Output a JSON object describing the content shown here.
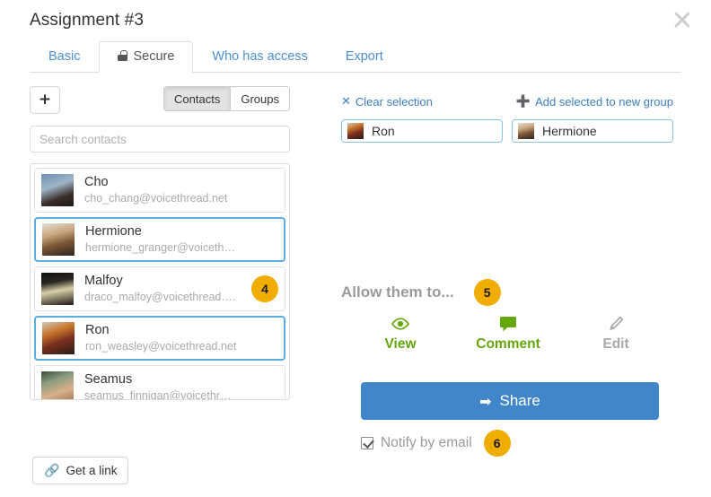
{
  "header": {
    "title": "Assignment #3",
    "close_icon": "close-icon"
  },
  "tabs": [
    {
      "label": "Basic",
      "active": false,
      "icon": null
    },
    {
      "label": "Secure",
      "active": true,
      "icon": "lock-icon"
    },
    {
      "label": "Who has access",
      "active": false,
      "icon": null
    },
    {
      "label": "Export",
      "active": false,
      "icon": null
    }
  ],
  "left_panel": {
    "add_button_label": "+",
    "segmented": {
      "contacts_label": "Contacts",
      "groups_label": "Groups",
      "selected": "Contacts"
    },
    "search": {
      "placeholder": "Search contacts",
      "value": ""
    },
    "contacts": [
      {
        "name": "Cho",
        "email": "cho_chang@voicethread.net",
        "selected": false,
        "badge": null
      },
      {
        "name": "Hermione",
        "email": "hermione_granger@voiceth…",
        "selected": true,
        "badge": null
      },
      {
        "name": "Malfoy",
        "email": "draco_malfoy@voicethread….",
        "selected": false,
        "badge": "4"
      },
      {
        "name": "Ron",
        "email": "ron_weasley@voicethread.net",
        "selected": true,
        "badge": null
      },
      {
        "name": "Seamus",
        "email": "seamus_finnigan@voicethr…",
        "selected": false,
        "badge": null
      }
    ],
    "get_link_label": "Get a link",
    "get_link_icon": "link-icon"
  },
  "right_panel": {
    "clear_selection_label": "Clear selection",
    "clear_selection_icon": "x-icon",
    "add_to_group_label": "Add selected to new group",
    "add_to_group_icon": "plus-icon",
    "selected_chips": [
      {
        "label": "Ron"
      },
      {
        "label": "Hermione"
      }
    ],
    "allow_label": "Allow them to...",
    "allow_badge": "5",
    "permissions": [
      {
        "label": "View",
        "icon": "eye-icon",
        "enabled": true
      },
      {
        "label": "Comment",
        "icon": "comment-icon",
        "enabled": true
      },
      {
        "label": "Edit",
        "icon": "pencil-icon",
        "enabled": false
      }
    ],
    "share_button_label": "Share",
    "share_button_icon": "share-arrow-icon",
    "notify": {
      "label": "Notify by email",
      "checked": true,
      "badge": "6"
    }
  },
  "colors": {
    "link_blue": "#3a7fc1",
    "tab_blue": "#4a90d9",
    "share_blue": "#4186c8",
    "selection_blue": "#5bade0",
    "badge_amber": "#f0ad00",
    "permission_green": "#63a70a",
    "muted_gray": "#9a9a9a"
  }
}
